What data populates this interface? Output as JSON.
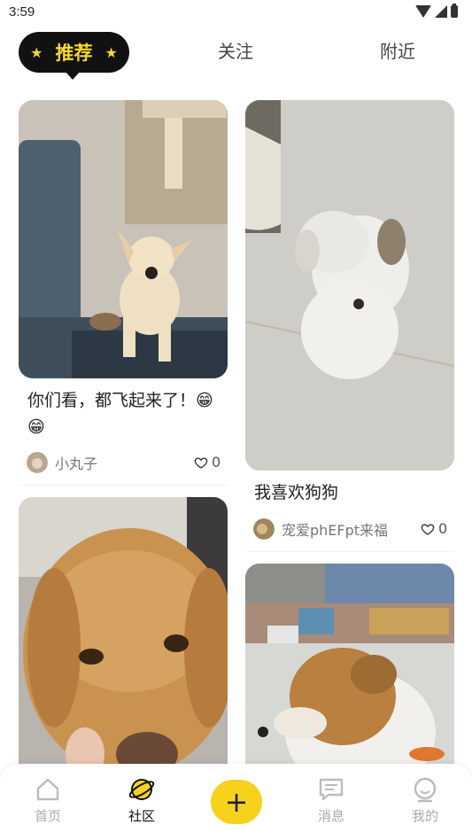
{
  "status": {
    "time": "3:59"
  },
  "tabs": {
    "active": "推荐",
    "follow": "关注",
    "nearby": "附近"
  },
  "posts": [
    {
      "title": "你们看，都飞起来了！😁😁",
      "author": "小丸子",
      "likes": "0"
    },
    {
      "title": "我喜欢狗狗",
      "author": "宠爱phEFpt来福",
      "likes": "0"
    },
    {
      "title": "",
      "author": "",
      "likes": ""
    },
    {
      "title": "",
      "author": "",
      "likes": ""
    }
  ],
  "nav": {
    "home": "首页",
    "community": "社区",
    "add": "+",
    "messages": "消息",
    "mine": "我的"
  },
  "colors": {
    "accent": "#f7d21d",
    "active_tab_bg": "#111111",
    "active_tab_text": "#f7d733"
  }
}
